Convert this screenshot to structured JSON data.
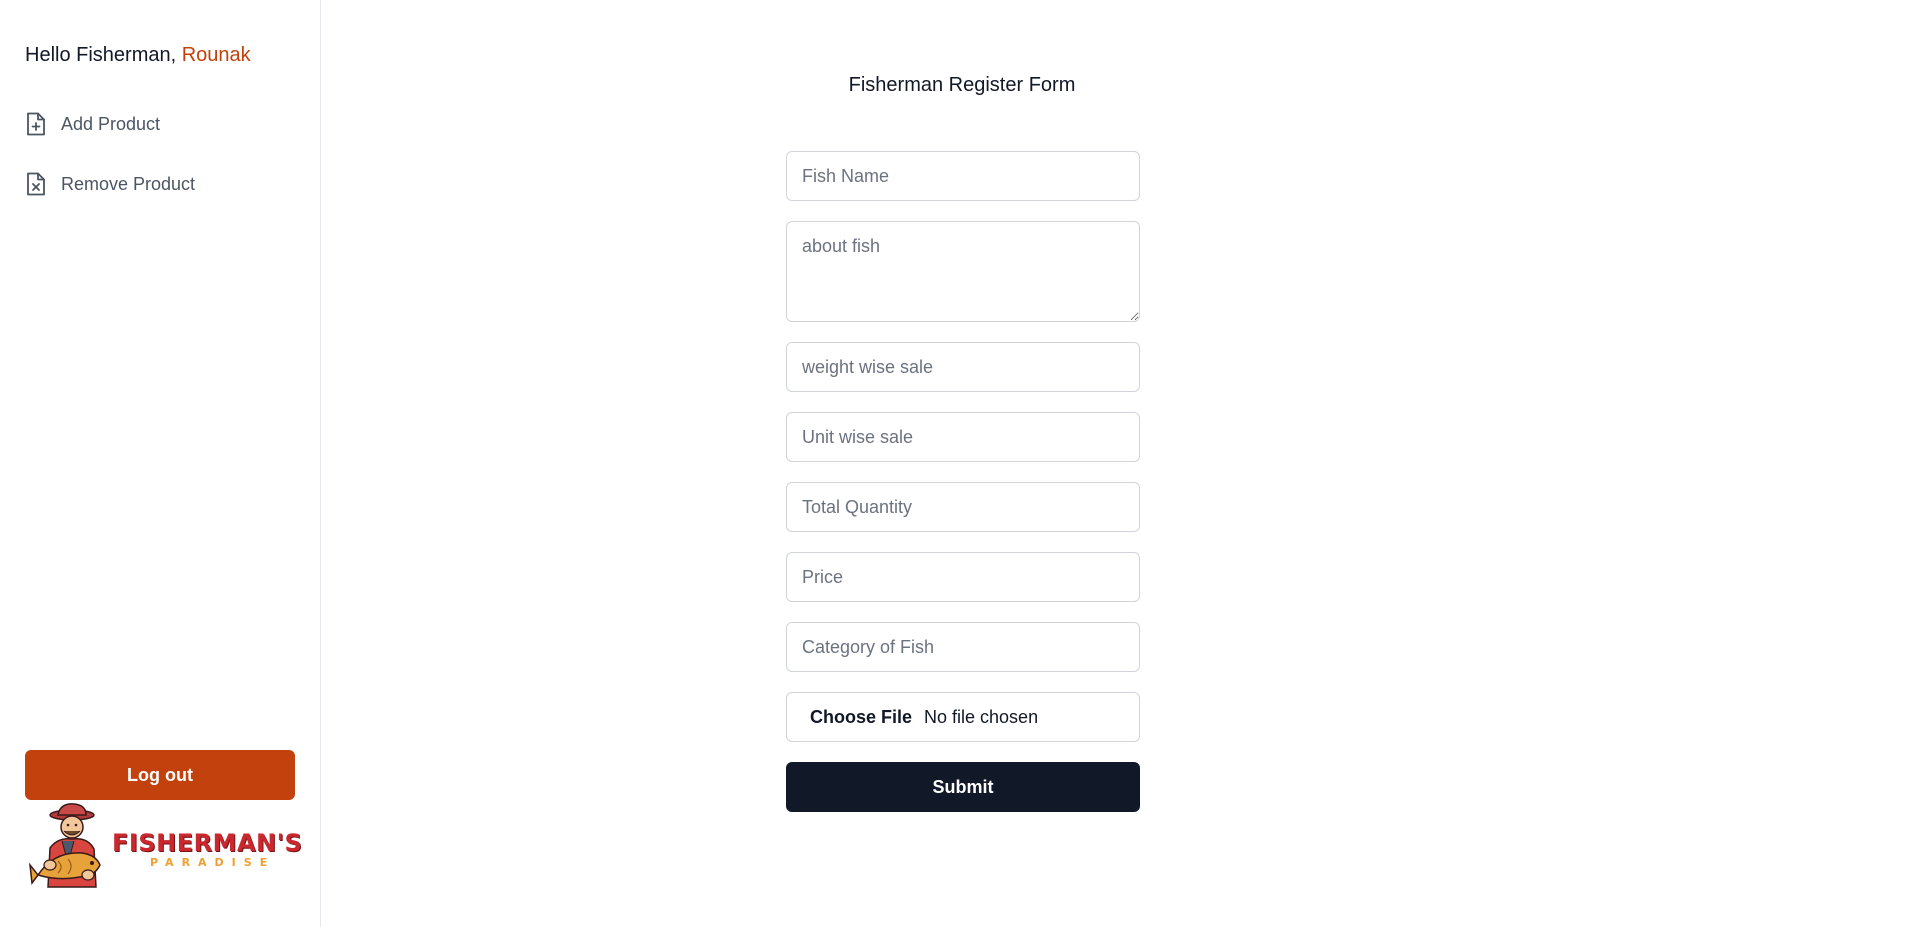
{
  "sidebar": {
    "greeting_prefix": "Hello Fisherman,",
    "user_name": "Rounak",
    "items": [
      {
        "label": "Add Product",
        "icon": "file-plus-icon"
      },
      {
        "label": "Remove Product",
        "icon": "file-x-icon"
      }
    ],
    "logout_label": "Log out",
    "logo": {
      "title": "FISHERMAN'S",
      "subtitle": "PARADISE"
    }
  },
  "form": {
    "title": "Fisherman Register Form",
    "fields": {
      "fish_name": {
        "placeholder": "Fish Name",
        "value": ""
      },
      "about": {
        "placeholder": "about fish",
        "value": ""
      },
      "weight_wise_sale": {
        "placeholder": "weight wise sale",
        "value": ""
      },
      "unit_wise_sale": {
        "placeholder": "Unit wise sale",
        "value": ""
      },
      "total_quantity": {
        "placeholder": "Total Quantity",
        "value": ""
      },
      "price": {
        "placeholder": "Price",
        "value": ""
      },
      "category": {
        "placeholder": "Category of Fish",
        "value": ""
      }
    },
    "file": {
      "button_label": "Choose File",
      "status": "No file chosen"
    },
    "submit_label": "Submit"
  },
  "colors": {
    "accent": "#c2410c",
    "submit": "#111827",
    "border": "#d1d5db"
  }
}
